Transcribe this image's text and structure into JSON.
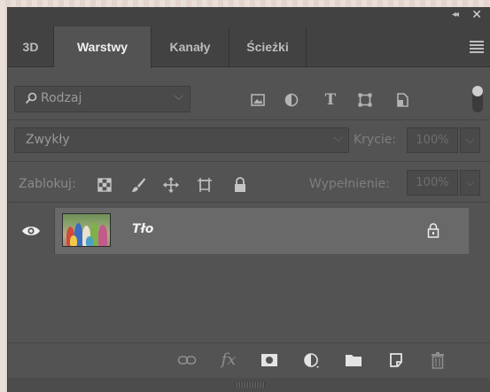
{
  "titlebar": {
    "collapse_glyph": "◂◂",
    "close_glyph": "✕"
  },
  "tabs": [
    {
      "label": "3D",
      "active": false
    },
    {
      "label": "Warstwy",
      "active": true
    },
    {
      "label": "Kanały",
      "active": false
    },
    {
      "label": "Ścieżki",
      "active": false
    }
  ],
  "filter": {
    "kind_label": "Rodzaj",
    "icons": [
      "image-filter-icon",
      "adjustment-filter-icon",
      "type-filter-icon",
      "shape-filter-icon",
      "smart-object-filter-icon"
    ],
    "type_glyph": "T"
  },
  "blend": {
    "mode": "Zwykły",
    "opacity_label": "Krycie:",
    "opacity_value": "100%"
  },
  "locks": {
    "label": "Zablokuj:",
    "fill_label": "Wypełnienie:",
    "fill_value": "100%"
  },
  "layers": [
    {
      "name": "Tło",
      "visible": true,
      "locked": true
    }
  ],
  "bottom_icons": [
    "link-icon",
    "fx-icon",
    "mask-icon",
    "adjustment-icon",
    "folder-icon",
    "new-layer-icon",
    "trash-icon"
  ],
  "bottom_fx_label": "fx",
  "colors": {
    "panel": "#535353",
    "tabbar": "#424242",
    "selected_layer": "#696969"
  }
}
